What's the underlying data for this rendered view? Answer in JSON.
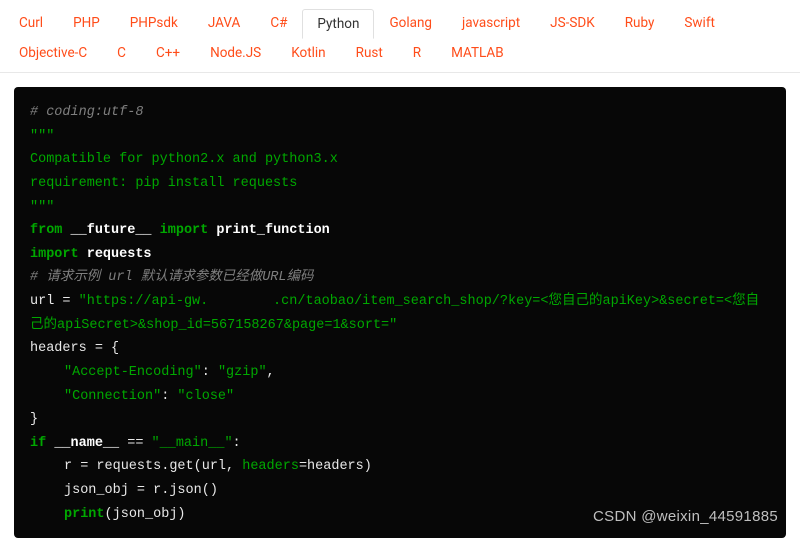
{
  "tabs": {
    "items": [
      "Curl",
      "PHP",
      "PHPsdk",
      "JAVA",
      "C#",
      "Python",
      "Golang",
      "javascript",
      "JS-SDK",
      "Ruby",
      "Swift",
      "Objective-C",
      "C",
      "C++",
      "Node.JS",
      "Kotlin",
      "Rust",
      "R",
      "MATLAB"
    ],
    "active": "Python"
  },
  "code": {
    "c1": "# coding:utf-8",
    "dq": "\"\"\"",
    "d1": "Compatible for python2.x and python3.x",
    "d2": "requirement: pip install requests",
    "kw_from": "from",
    "mod_future": "__future__",
    "kw_import": "import",
    "fn_print": "print_function",
    "mod_requests": "requests",
    "c2": "# 请求示例 url 默认请求参数已经做URL编码",
    "url_var": "url",
    "eq": " = ",
    "url_val": "\"https://api-gw.        .cn/taobao/item_search_shop/?key=<您自己的apiKey>&secret=<您自己的apiSecret>&shop_id=567158267&page=1&sort=\"",
    "hdr_var": "headers",
    "brace_open": " = {",
    "h1k": "\"Accept-Encoding\"",
    "h1v": "\"gzip\"",
    "h2k": "\"Connection\"",
    "h2v": "\"close\"",
    "brace_close": "}",
    "kw_if": "if",
    "dname": "__name__",
    "deq": " == ",
    "dmain": "\"__main__\"",
    "colon": ":",
    "l1a": "r = requests.get(url, ",
    "l1b": "headers",
    "l1c": "=headers)",
    "l2": "json_obj = r.json()",
    "l3a": "print",
    "l3b": "(json_obj)"
  },
  "watermark": "CSDN @weixin_44591885"
}
